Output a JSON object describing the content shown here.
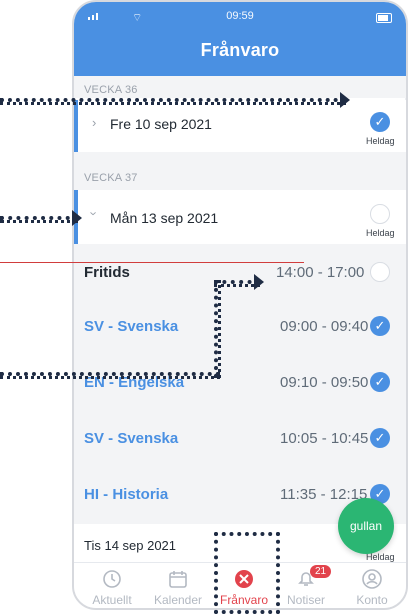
{
  "status_bar": {
    "time": "09:59"
  },
  "header": {
    "title": "Frånvaro"
  },
  "weeks": [
    {
      "label": "VECKA 36",
      "days": [
        {
          "date": "Fre 10 sep 2021",
          "heldag": "Heldag",
          "checked": true
        }
      ]
    },
    {
      "label": "VECKA 37",
      "days": [
        {
          "date": "Mån 13 sep 2021",
          "heldag": "Heldag",
          "checked": false
        }
      ]
    }
  ],
  "lessons": [
    {
      "name": "Fritids",
      "time": "14:00 - 17:00",
      "checked": false
    },
    {
      "name": "SV - Svenska",
      "time": "09:00 - 09:40",
      "checked": true
    },
    {
      "name": "EN - Engelska",
      "time": "09:10 - 09:50",
      "checked": true
    },
    {
      "name": "SV - Svenska",
      "time": "10:05 - 10:45",
      "checked": true
    },
    {
      "name": "HI - Historia",
      "time": "11:35 - 12:15",
      "checked": true
    }
  ],
  "next_day": {
    "date": "Tis 14 sep 2021",
    "heldag": "Heldag"
  },
  "fab": {
    "label": "gullan"
  },
  "tabs": [
    {
      "label": "Aktuellt",
      "icon": "clock-icon"
    },
    {
      "label": "Kalender",
      "icon": "calendar-icon"
    },
    {
      "label": "Frånvaro",
      "icon": "absence-icon",
      "active": true
    },
    {
      "label": "Notiser",
      "icon": "bell-icon",
      "badge": "21"
    },
    {
      "label": "Konto",
      "icon": "user-icon"
    }
  ],
  "colors": {
    "primary": "#4a90e2",
    "active_tab": "#e2434c",
    "fab": "#2bb673",
    "annotation": "#1f2c44"
  }
}
